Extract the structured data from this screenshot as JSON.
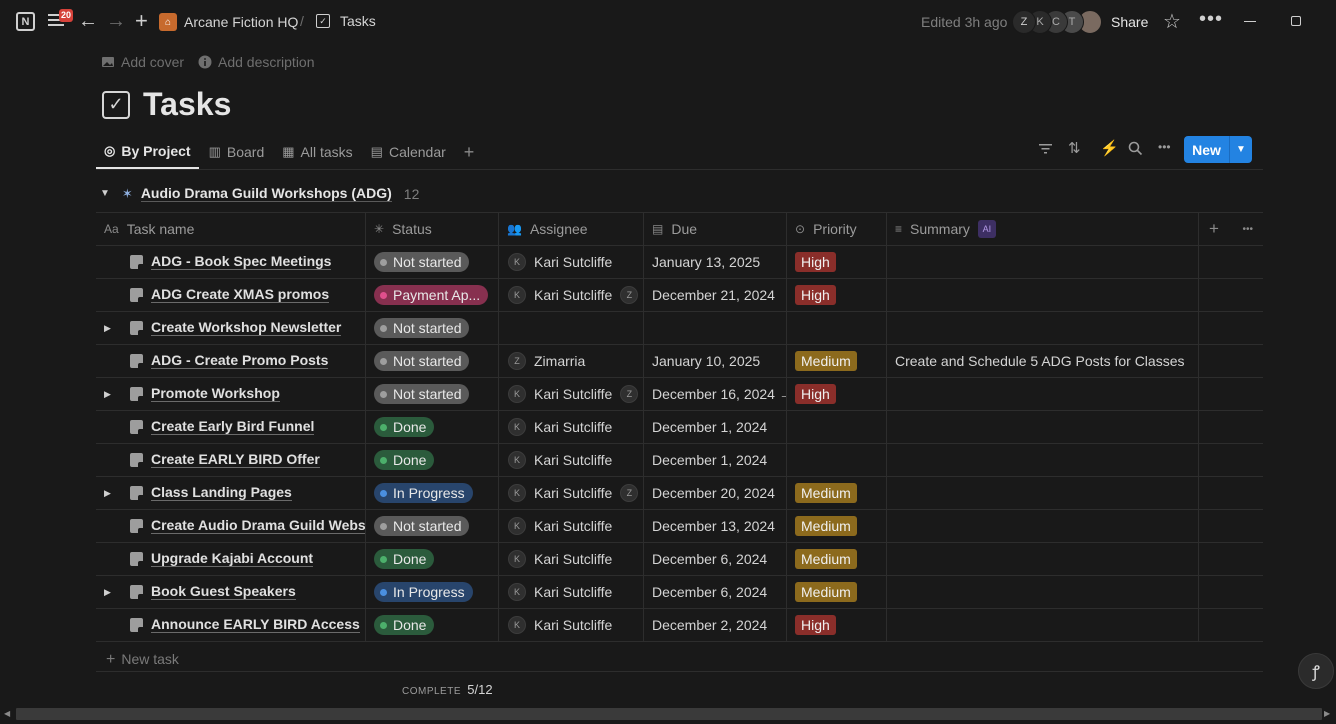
{
  "topbar": {
    "badge_count": "20",
    "workspace": "Arcane Fiction HQ",
    "separator": "/",
    "page": "Tasks",
    "edited": "Edited 3h ago",
    "avatars": [
      "Z",
      "K",
      "C",
      "T"
    ],
    "share_label": "Share"
  },
  "page": {
    "add_cover": "Add cover",
    "add_description": "Add description",
    "title": "Tasks"
  },
  "views": [
    {
      "label": "By Project",
      "icon": "target-icon",
      "active": true
    },
    {
      "label": "Board",
      "icon": "board-icon"
    },
    {
      "label": "All tasks",
      "icon": "table-icon"
    },
    {
      "label": "Calendar",
      "icon": "calendar-icon"
    }
  ],
  "toolbar": {
    "new_label": "New"
  },
  "group": {
    "name": "Audio Drama Guild Workshops (ADG)",
    "count": "12"
  },
  "columns": {
    "name": "Task name",
    "name_prefix": "Aa",
    "status": "Status",
    "assignee": "Assignee",
    "due": "Due",
    "priority": "Priority",
    "summary": "Summary",
    "ai_badge": "AI"
  },
  "rows": [
    {
      "name": "ADG - Book Spec Meetings",
      "expand": false,
      "status": "Not started",
      "assignee": "Kari Sutcliffe",
      "initial": "K",
      "extra": "",
      "due": "January 13, 2025",
      "priority": "High",
      "summary": ""
    },
    {
      "name": "ADG Create XMAS promos",
      "expand": false,
      "status": "Payment Ap...",
      "assignee": "Kari Sutcliffe",
      "initial": "K",
      "extra": "Z",
      "due": "December 21, 2024",
      "priority": "High",
      "summary": ""
    },
    {
      "name": "Create Workshop Newsletter",
      "expand": true,
      "status": "Not started",
      "assignee": "",
      "initial": "",
      "extra": "",
      "due": "",
      "priority": "",
      "summary": ""
    },
    {
      "name": "ADG - Create Promo Posts",
      "expand": false,
      "status": "Not started",
      "assignee": "Zimarria",
      "initial": "Z",
      "extra": "",
      "due": "January 10, 2025",
      "priority": "Medium",
      "summary": "Create and Schedule 5 ADG Posts for Classes"
    },
    {
      "name": "Promote Workshop",
      "expand": true,
      "status": "Not started",
      "assignee": "Kari Sutcliffe",
      "initial": "K",
      "extra": "Z",
      "due": "December 16, 2024 →",
      "priority": "High",
      "summary": ""
    },
    {
      "name": "Create Early Bird Funnel",
      "expand": false,
      "status": "Done",
      "assignee": "Kari Sutcliffe",
      "initial": "K",
      "extra": "",
      "due": "December 1, 2024",
      "priority": "",
      "summary": ""
    },
    {
      "name": "Create EARLY BIRD Offer",
      "expand": false,
      "status": "Done",
      "assignee": "Kari Sutcliffe",
      "initial": "K",
      "extra": "",
      "due": "December 1, 2024",
      "priority": "",
      "summary": ""
    },
    {
      "name": "Class Landing Pages",
      "expand": true,
      "status": "In Progress",
      "assignee": "Kari Sutcliffe",
      "initial": "K",
      "extra": "Z",
      "due": "December 20, 2024",
      "priority": "Medium",
      "summary": ""
    },
    {
      "name": "Create Audio Drama Guild Websit",
      "expand": false,
      "status": "Not started",
      "assignee": "Kari Sutcliffe",
      "initial": "K",
      "extra": "",
      "due": "December 13, 2024",
      "priority": "Medium",
      "summary": ""
    },
    {
      "name": "Upgrade Kajabi Account",
      "expand": false,
      "status": "Done",
      "assignee": "Kari Sutcliffe",
      "initial": "K",
      "extra": "",
      "due": "December 6, 2024",
      "priority": "Medium",
      "summary": ""
    },
    {
      "name": "Book Guest Speakers",
      "expand": true,
      "status": "In Progress",
      "assignee": "Kari Sutcliffe",
      "initial": "K",
      "extra": "",
      "due": "December 6, 2024",
      "priority": "Medium",
      "summary": ""
    },
    {
      "name": "Announce EARLY BIRD Access",
      "expand": false,
      "status": "Done",
      "assignee": "Kari Sutcliffe",
      "initial": "K",
      "extra": "",
      "due": "December 2, 2024",
      "priority": "High",
      "summary": ""
    }
  ],
  "footer": {
    "new_task": "New task",
    "complete_label": "COMPLETE",
    "complete_value": "5/12"
  }
}
